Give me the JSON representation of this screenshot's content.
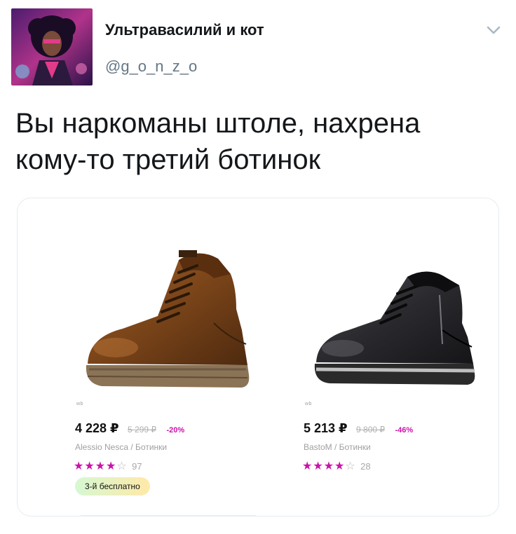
{
  "author": {
    "name": "Ультравасилий и кот",
    "handle": "@g_o_n_z_o"
  },
  "tweet": {
    "text_line1": "Вы наркоманы штоле, нахрена",
    "text_line2": "кому-то третий ботинок"
  },
  "icons": {
    "menu": "chevron-down-icon",
    "star_filled": "star-filled-icon",
    "star_empty": "star-empty-icon"
  },
  "colors": {
    "accent": "#cb11ab",
    "promo_start": "#d6f8d2",
    "promo_end": "#ffe9a8"
  },
  "products": [
    {
      "watermark": "wb",
      "price": "4 228 ₽",
      "old_price": "5 299 ₽",
      "discount": "-20%",
      "brand_line": "Alessio Nesca / Ботинки",
      "rating": 4,
      "reviews": "97",
      "promo": "3-й бесплатно"
    },
    {
      "watermark": "wb",
      "price": "5 213 ₽",
      "old_price": "9 800 ₽",
      "discount": "-46%",
      "brand_line": "BastoM / Ботинки",
      "rating": 4,
      "reviews": "28"
    }
  ]
}
